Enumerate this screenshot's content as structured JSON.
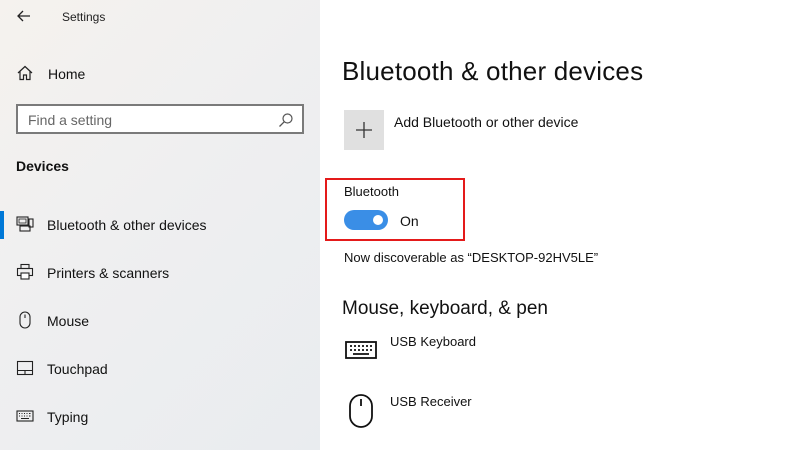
{
  "window": {
    "title": "Settings"
  },
  "sidebar": {
    "home_label": "Home",
    "search_placeholder": "Find a setting",
    "section_heading": "Devices",
    "items": [
      {
        "label": "Bluetooth & other devices",
        "icon": "bluetooth-devices-icon",
        "selected": true
      },
      {
        "label": "Printers & scanners",
        "icon": "printer-icon",
        "selected": false
      },
      {
        "label": "Mouse",
        "icon": "mouse-icon",
        "selected": false
      },
      {
        "label": "Touchpad",
        "icon": "touchpad-icon",
        "selected": false
      },
      {
        "label": "Typing",
        "icon": "keyboard-icon",
        "selected": false
      }
    ]
  },
  "main": {
    "title": "Bluetooth & other devices",
    "add_device_label": "Add Bluetooth or other device",
    "bluetooth": {
      "label": "Bluetooth",
      "state": "On",
      "enabled": true
    },
    "discoverable_text": "Now discoverable as “DESKTOP-92HV5LE”",
    "section_title": "Mouse, keyboard, & pen",
    "devices": [
      {
        "name": "USB Keyboard",
        "icon": "keyboard-icon"
      },
      {
        "name": "USB Receiver",
        "icon": "mouse-icon"
      }
    ]
  },
  "colors": {
    "accent": "#0078d7",
    "toggle_on": "#3a8ee6",
    "highlight_box": "#e41a1a"
  }
}
